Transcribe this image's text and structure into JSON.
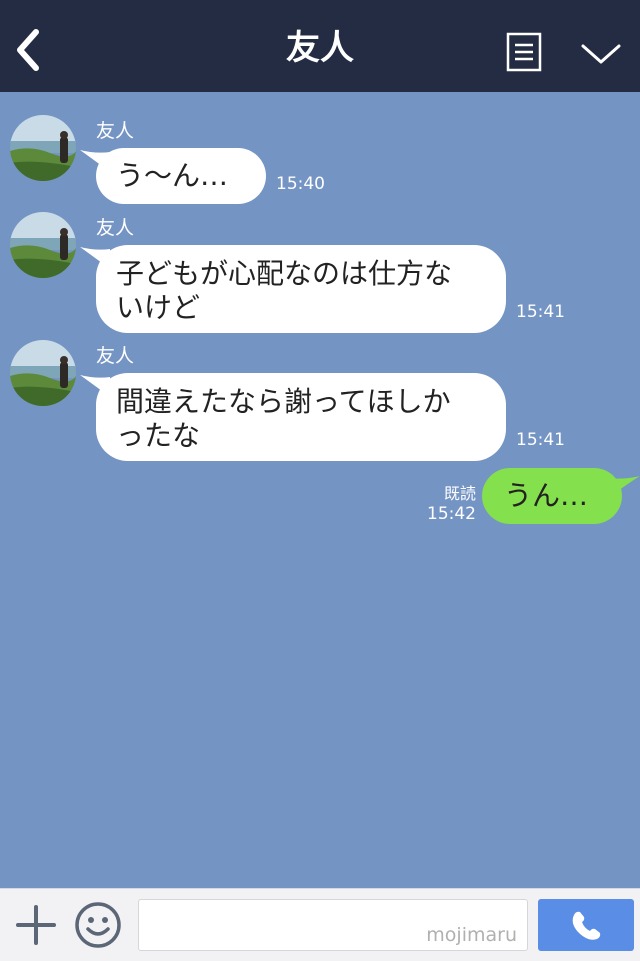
{
  "header": {
    "title": "友人",
    "back_icon": "chevron-left-icon",
    "menu_icon": "list-menu-icon",
    "collapse_icon": "chevron-down-icon"
  },
  "messages": [
    {
      "sender": "友人",
      "text": "う〜ん…",
      "time": "15:40"
    },
    {
      "sender": "友人",
      "text_lines": [
        "子どもが心配なのは仕方な",
        "いけど"
      ],
      "time": "15:41"
    },
    {
      "sender": "友人",
      "text_lines": [
        "間違えたなら謝ってほしか",
        "ったな"
      ],
      "time": "15:41"
    }
  ],
  "my_message": {
    "text": "うん…",
    "read": "既読",
    "time": "15:42"
  },
  "input_bar": {
    "plus_icon": "plus-icon",
    "emoji_icon": "smiley-icon",
    "watermark": "mojimaru",
    "call_icon": "phone-icon"
  },
  "colors": {
    "header_bg": "#232c42",
    "chat_bg": "#7494c4",
    "my_bubble": "#84e04c",
    "call_button": "#5a8ee6"
  }
}
